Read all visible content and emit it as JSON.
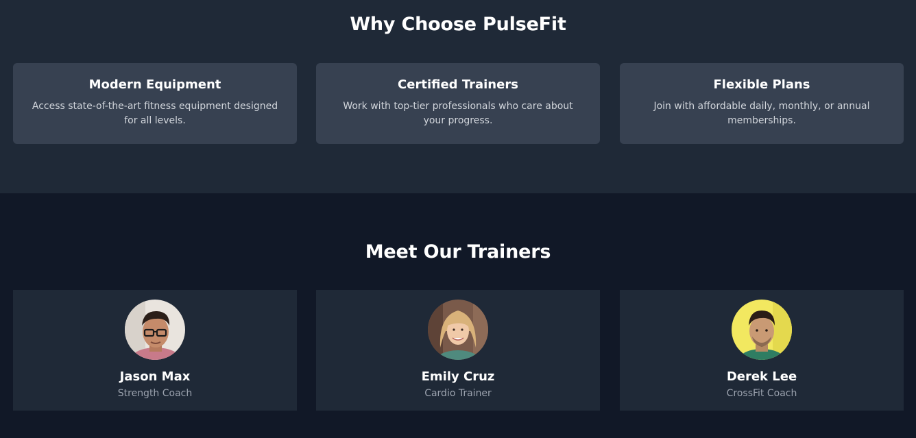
{
  "why": {
    "title": "Why Choose PulseFit",
    "features": [
      {
        "title": "Modern Equipment",
        "text": "Access state-of-the-art fitness equipment designed for all levels."
      },
      {
        "title": "Certified Trainers",
        "text": "Work with top-tier professionals who care about your progress."
      },
      {
        "title": "Flexible Plans",
        "text": "Join with affordable daily, monthly, or annual memberships."
      }
    ]
  },
  "trainers": {
    "title": "Meet Our Trainers",
    "list": [
      {
        "name": "Jason Max",
        "role": "Strength Coach"
      },
      {
        "name": "Emily Cruz",
        "role": "Cardio Trainer"
      },
      {
        "name": "Derek Lee",
        "role": "CrossFit Coach"
      }
    ]
  },
  "colors": {
    "section_bg": "#1f2937",
    "card_bg": "#374151",
    "page_bg": "#111827",
    "heading": "#ffffff",
    "body_text": "#d1d5db",
    "muted_text": "#9ca3af"
  }
}
